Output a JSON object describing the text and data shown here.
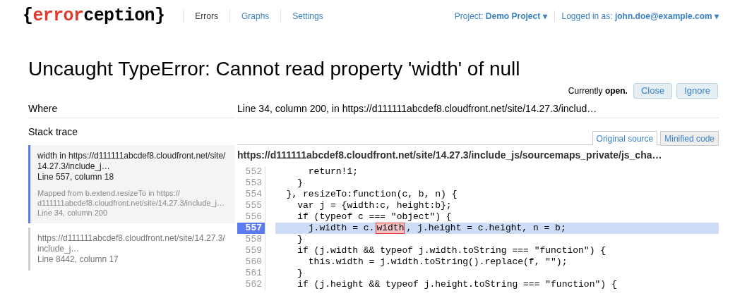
{
  "header": {
    "logo": {
      "brace_open": "{",
      "accent": "error",
      "rest": "ception",
      "brace_close": "}"
    },
    "nav": [
      {
        "label": "Errors",
        "selected": true
      },
      {
        "label": "Graphs",
        "selected": false
      },
      {
        "label": "Settings",
        "selected": false
      }
    ],
    "project": {
      "label": "Project:",
      "value": "Demo Project ▾"
    },
    "user": {
      "label": "Logged in as:",
      "value": "john.doe@example.com ▾"
    }
  },
  "title": "Uncaught TypeError: Cannot read property 'width' of null",
  "status": {
    "text": "Currently **open.**",
    "buttons": [
      "Close",
      "Ignore"
    ]
  },
  "where": {
    "label": "Where",
    "value": "Line 34, column 200, in https://d111111abcdef8.cloudfront.net/site/14.27.3/includ…"
  },
  "stack_trace": {
    "label": "Stack trace",
    "frames": [
      {
        "title": "width in https://d111111abcdef8.cloudfront.net/site/14.27.3/include_j…",
        "location": "Line 557, column 18",
        "mapped_from": "Mapped from b.extend.resizeTo in https://d111111abcdef8.cloudfront.net/site/14.27.3/include_j…",
        "mapped_location": "Line 34, column 200",
        "selected": true
      },
      {
        "title": "https://d111111abcdef8.cloudfront.net/site/14.27.3/include_j…",
        "location": "Line 8442, column 17",
        "selected": false
      }
    ]
  },
  "source": {
    "tabs": [
      {
        "label": "Original source",
        "selected": true
      },
      {
        "label": "Minified code",
        "selected": false
      }
    ],
    "file": "https://d111111abcdef8.cloudfront.net/site/14.27.3/include_js/sourcemaps_private/js_cha…",
    "lines": [
      {
        "number": "552",
        "code": "      return!1;",
        "selected": false
      },
      {
        "number": "553",
        "code": "    }",
        "selected": false
      },
      {
        "number": "554",
        "code": "  }, resizeTo:function(c, b, n) {",
        "selected": false
      },
      {
        "number": "555",
        "code": "    var j = {width:c, height:b};",
        "selected": false
      },
      {
        "number": "556",
        "code": "    if (typeof c === \"object\") {",
        "selected": false
      },
      {
        "number": "557",
        "code": "      j.width = c.",
        "error_token": "width",
        "code_after": ", j.height = c.height, n = b;",
        "selected": true
      },
      {
        "number": "558",
        "code": "    }",
        "selected": false
      },
      {
        "number": "559",
        "code": "    if (j.width && typeof j.width.toString === \"function\") {",
        "selected": false
      },
      {
        "number": "560",
        "code": "      this.width = j.width.toString().replace(f, \"\");",
        "selected": false
      },
      {
        "number": "561",
        "code": "    }",
        "selected": false
      },
      {
        "number": "562",
        "code": "    if (j.height && typeof j.height.toString === \"function\") {",
        "selected": false
      }
    ]
  }
}
